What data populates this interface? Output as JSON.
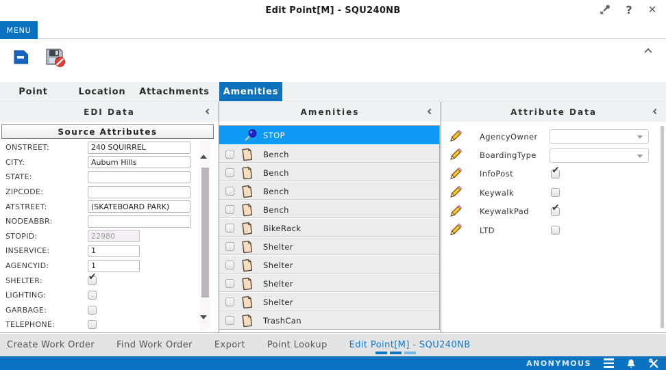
{
  "window": {
    "title": "Edit Point[M]  - SQU240NB",
    "menu_label": "MENU",
    "help_glyph": "?",
    "close_glyph": "✕",
    "icons": [
      "pin-popout-icon",
      "help-icon",
      "close-icon"
    ]
  },
  "toolbar": {
    "icons": [
      "save-icon",
      "save-disabled-icon",
      "chevron-up-icon"
    ]
  },
  "tabs": [
    {
      "label": "Point",
      "active": false
    },
    {
      "label": "Location",
      "active": false
    },
    {
      "label": "Attachments",
      "active": false
    },
    {
      "label": "Amenities",
      "active": true
    }
  ],
  "edi_panel": {
    "title": "EDI Data",
    "collapse_icon": "chevron-left-icon",
    "section_title": "Source Attributes",
    "fields": [
      {
        "label": "ONSTREET:",
        "type": "text",
        "value": "240 SQUIRREL",
        "size": "wide",
        "disabled": false
      },
      {
        "label": "CITY:",
        "type": "text",
        "value": "Auburn Hills",
        "size": "wide",
        "disabled": false
      },
      {
        "label": "STATE:",
        "type": "text",
        "value": "",
        "size": "wide",
        "disabled": false
      },
      {
        "label": "ZIPCODE:",
        "type": "text",
        "value": "",
        "size": "wide",
        "disabled": false
      },
      {
        "label": "ATSTREET:",
        "type": "text",
        "value": "(SKATEBOARD PARK)",
        "size": "wide",
        "disabled": false
      },
      {
        "label": "NODEABBR:",
        "type": "text",
        "value": "",
        "size": "wide",
        "disabled": false
      },
      {
        "label": "STOPID:",
        "type": "text",
        "value": "22980",
        "size": "small",
        "disabled": true
      },
      {
        "label": "INSERVICE:",
        "type": "text",
        "value": "1",
        "size": "small",
        "disabled": false
      },
      {
        "label": "AGENCYID:",
        "type": "text",
        "value": "1",
        "size": "small",
        "disabled": false
      },
      {
        "label": "SHELTER:",
        "type": "checkbox",
        "checked": true
      },
      {
        "label": "LIGHTING:",
        "type": "checkbox",
        "checked": false
      },
      {
        "label": "GARBAGE:",
        "type": "checkbox",
        "checked": false
      },
      {
        "label": "TELEPHONE:",
        "type": "checkbox",
        "checked": false
      }
    ]
  },
  "amenities_panel": {
    "title": "Amenities",
    "collapse_icon": "chevron-left-icon",
    "items": [
      {
        "label": "STOP",
        "selected": true,
        "icon": "pushpin-icon",
        "has_checkbox": false
      },
      {
        "label": "Bench",
        "selected": false,
        "icon": "document-icon",
        "has_checkbox": true,
        "checked": false
      },
      {
        "label": "Bench",
        "selected": false,
        "icon": "document-icon",
        "has_checkbox": true,
        "checked": false
      },
      {
        "label": "Bench",
        "selected": false,
        "icon": "document-icon",
        "has_checkbox": true,
        "checked": false
      },
      {
        "label": "Bench",
        "selected": false,
        "icon": "document-icon",
        "has_checkbox": true,
        "checked": false
      },
      {
        "label": "BikeRack",
        "selected": false,
        "icon": "document-icon",
        "has_checkbox": true,
        "checked": false
      },
      {
        "label": "Shelter",
        "selected": false,
        "icon": "document-icon",
        "has_checkbox": true,
        "checked": false
      },
      {
        "label": "Shelter",
        "selected": false,
        "icon": "document-icon",
        "has_checkbox": true,
        "checked": false
      },
      {
        "label": "Shelter",
        "selected": false,
        "icon": "document-icon",
        "has_checkbox": true,
        "checked": false
      },
      {
        "label": "Shelter",
        "selected": false,
        "icon": "document-icon",
        "has_checkbox": true,
        "checked": false
      },
      {
        "label": "TrashCan",
        "selected": false,
        "icon": "document-icon",
        "has_checkbox": true,
        "checked": false
      }
    ]
  },
  "attribute_panel": {
    "title": "Attribute Data",
    "collapse_icon": "chevron-left-icon",
    "row_icon": "pencil-icon",
    "rows": [
      {
        "label": "AgencyOwner",
        "control": "dropdown",
        "value": ""
      },
      {
        "label": "BoardingType",
        "control": "dropdown",
        "value": ""
      },
      {
        "label": "InfoPost",
        "control": "checkbox",
        "checked": true
      },
      {
        "label": "Keywalk",
        "control": "checkbox",
        "checked": false
      },
      {
        "label": "KeywalkPad",
        "control": "checkbox",
        "checked": true
      },
      {
        "label": "LTD",
        "control": "checkbox",
        "checked": false
      }
    ]
  },
  "bottom_nav": {
    "links": [
      {
        "label": "Create Work Order",
        "active": false
      },
      {
        "label": "Find Work Order",
        "active": false
      },
      {
        "label": "Export",
        "active": false
      },
      {
        "label": "Point Lookup",
        "active": false
      },
      {
        "label": "Edit Point[M]  - SQU240NB",
        "active": true
      }
    ]
  },
  "status_bar": {
    "user": "ANONYMOUS",
    "icons": [
      "menu-lines-icon",
      "bell-icon",
      "tools-icon"
    ]
  },
  "colors": {
    "accent_blue": "#0e72bd",
    "selected_row_blue": "#0f9bf5",
    "active_link_blue": "#1178c8",
    "status_bar_blue": "#0a73c2"
  }
}
